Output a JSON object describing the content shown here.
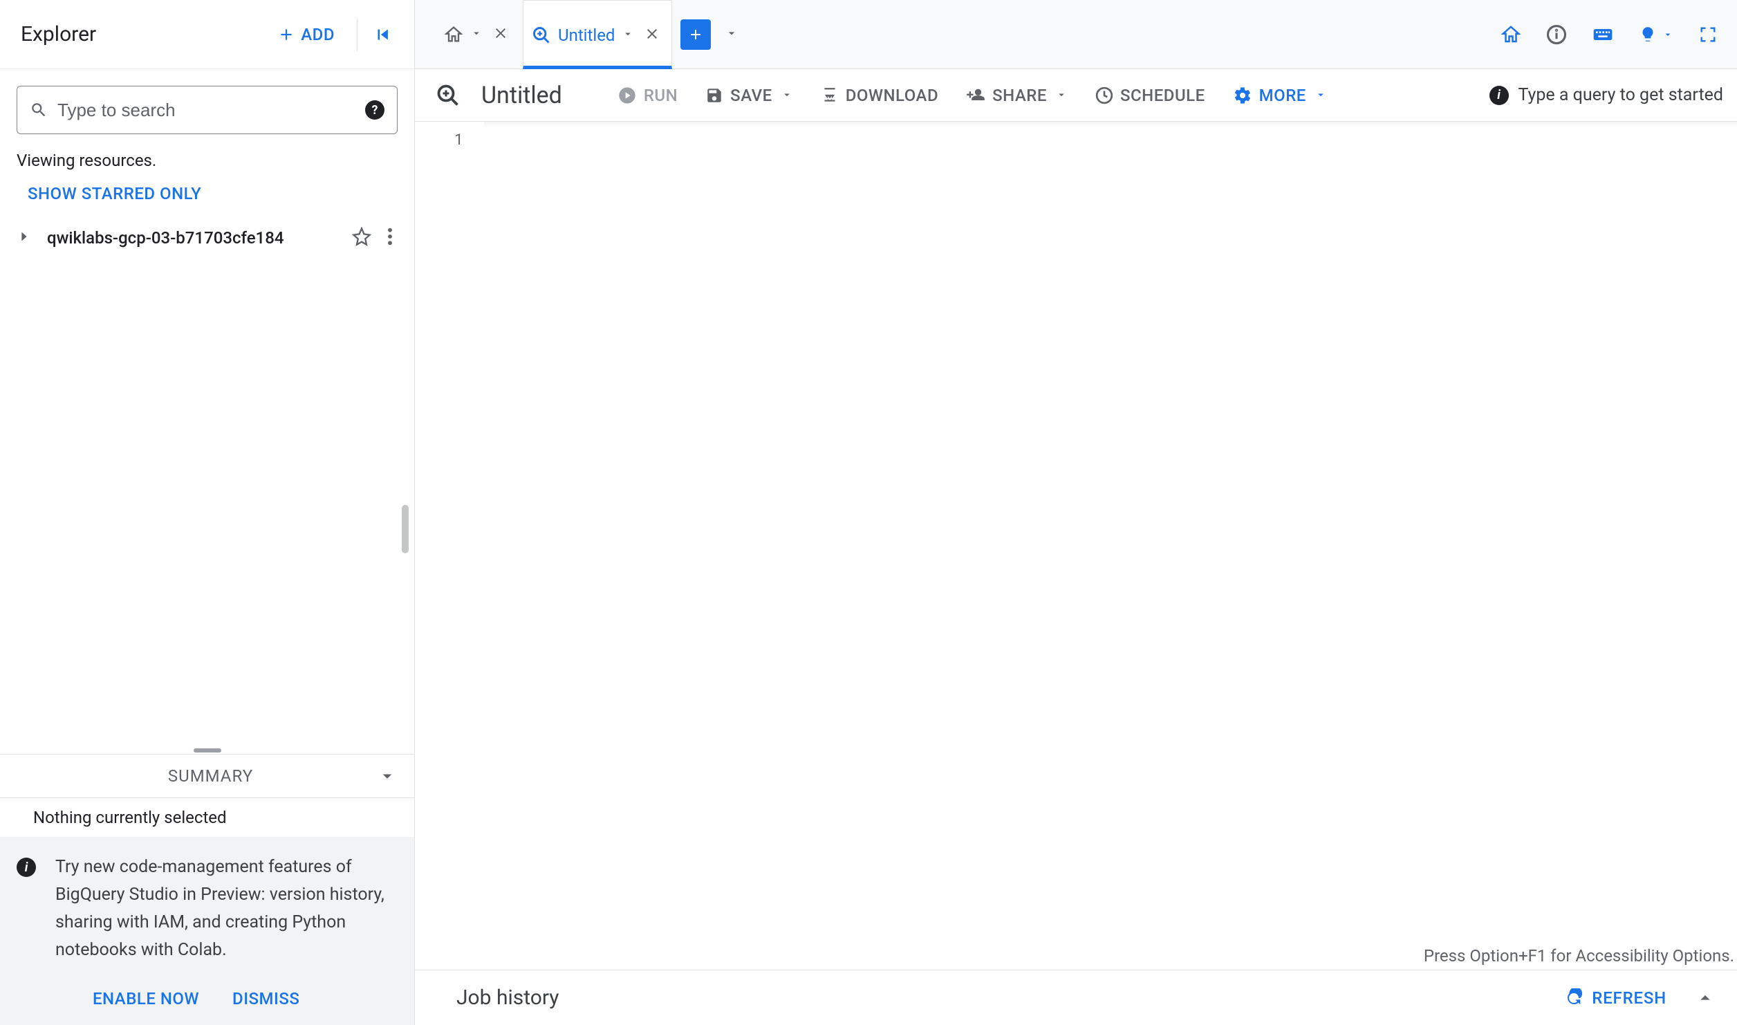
{
  "sidebar": {
    "title": "Explorer",
    "add_label": "ADD",
    "search_placeholder": "Type to search",
    "viewing_text": "Viewing resources.",
    "show_starred_label": "SHOW STARRED ONLY",
    "project_name": "qwiklabs-gcp-03-b71703cfe184",
    "summary_label": "SUMMARY",
    "nothing_selected": "Nothing currently selected",
    "info_text": "Try new code-management features of BigQuery Studio in Preview: version history, sharing with IAM, and creating Python notebooks with Colab.",
    "enable_now": "ENABLE NOW",
    "dismiss": "DISMISS"
  },
  "tabs": {
    "active_label": "Untitled"
  },
  "toolbar": {
    "title": "Untitled",
    "run": "RUN",
    "save": "SAVE",
    "download": "DOWNLOAD",
    "share": "SHARE",
    "schedule": "SCHEDULE",
    "more": "MORE",
    "prompt": "Type a query to get started"
  },
  "editor": {
    "line1": "1",
    "a11y_hint": "Press Option+F1 for Accessibility Options."
  },
  "job": {
    "title": "Job history",
    "refresh": "REFRESH"
  }
}
